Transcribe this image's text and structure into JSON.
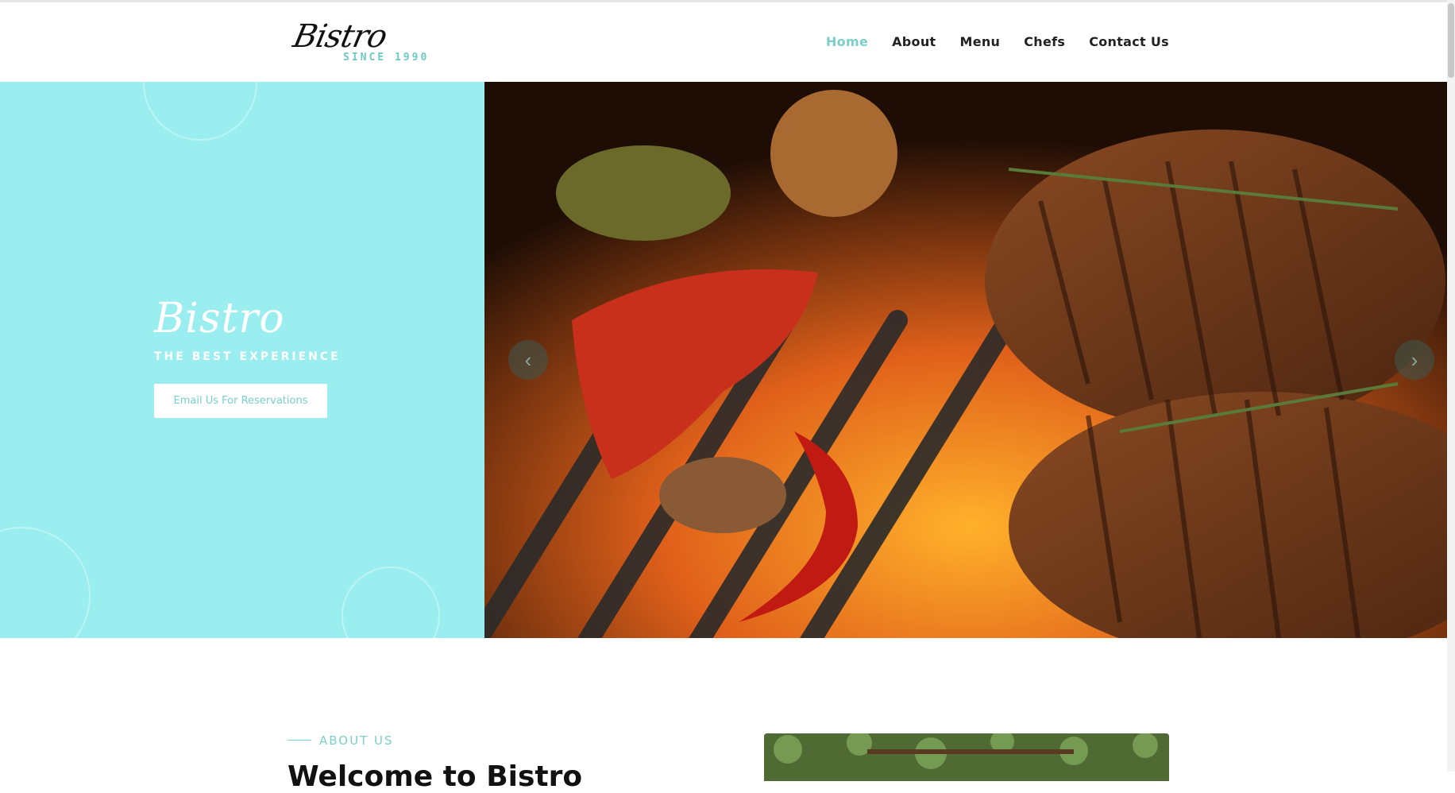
{
  "brand": {
    "script_name": "Bistro",
    "since": "SINCE 1990"
  },
  "nav": {
    "items": [
      {
        "label": "Home",
        "active": true
      },
      {
        "label": "About",
        "active": false
      },
      {
        "label": "Menu",
        "active": false
      },
      {
        "label": "Chefs",
        "active": false
      },
      {
        "label": "Contact Us",
        "active": false
      }
    ]
  },
  "hero": {
    "title": "Bistro",
    "subtitle": "THE BEST EXPERIENCE",
    "cta_label": "Email Us For Reservations",
    "prev_arrow": "‹",
    "next_arrow": "›"
  },
  "about": {
    "label": "ABOUT US",
    "heading": "Welcome to Bistro"
  },
  "colors": {
    "accent": "#7acfc8",
    "hero_left_bg": "#9aeeef",
    "text_dark": "#222222"
  },
  "icons": {
    "prev": "chevron-left-icon",
    "next": "chevron-right-icon"
  }
}
